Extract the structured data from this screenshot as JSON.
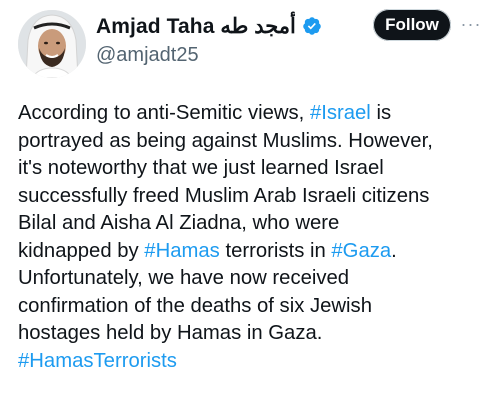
{
  "author": {
    "display_name": "Amjad Taha أمجد طه",
    "handle": "@amjadt25",
    "verified": true
  },
  "actions": {
    "follow_label": "Follow",
    "more_label": "···"
  },
  "tweet": {
    "lines": [
      [
        {
          "t": "According to anti-Semitic views, "
        },
        {
          "t": "#Israel",
          "link": true
        },
        {
          "t": " is"
        }
      ],
      [
        {
          "t": "portrayed as being against Muslims. However,"
        }
      ],
      [
        {
          "t": "it's noteworthy that we just learned Israel"
        }
      ],
      [
        {
          "t": "successfully freed Muslim Arab Israeli citizens"
        }
      ],
      [
        {
          "t": "Bilal and Aisha Al Ziadna, who were"
        }
      ],
      [
        {
          "t": "kidnapped by "
        },
        {
          "t": "#Hamas",
          "link": true
        },
        {
          "t": " terrorists in "
        },
        {
          "t": "#Gaza",
          "link": true
        },
        {
          "t": "."
        }
      ],
      [
        {
          "t": "Unfortunately, we have now received"
        }
      ],
      [
        {
          "t": "confirmation of the deaths of six Jewish"
        }
      ],
      [
        {
          "t": "hostages held by Hamas in Gaza."
        }
      ],
      [
        {
          "t": " "
        },
        {
          "t": "#HamasTerrorists",
          "link": true
        }
      ]
    ]
  },
  "colors": {
    "link": "#1d9bf0",
    "verified_badge": "#1d9bf0",
    "text": "#0f1419",
    "secondary": "#536471"
  },
  "icons": {
    "verified": "verified-badge-icon",
    "more": "more-dots-icon"
  }
}
